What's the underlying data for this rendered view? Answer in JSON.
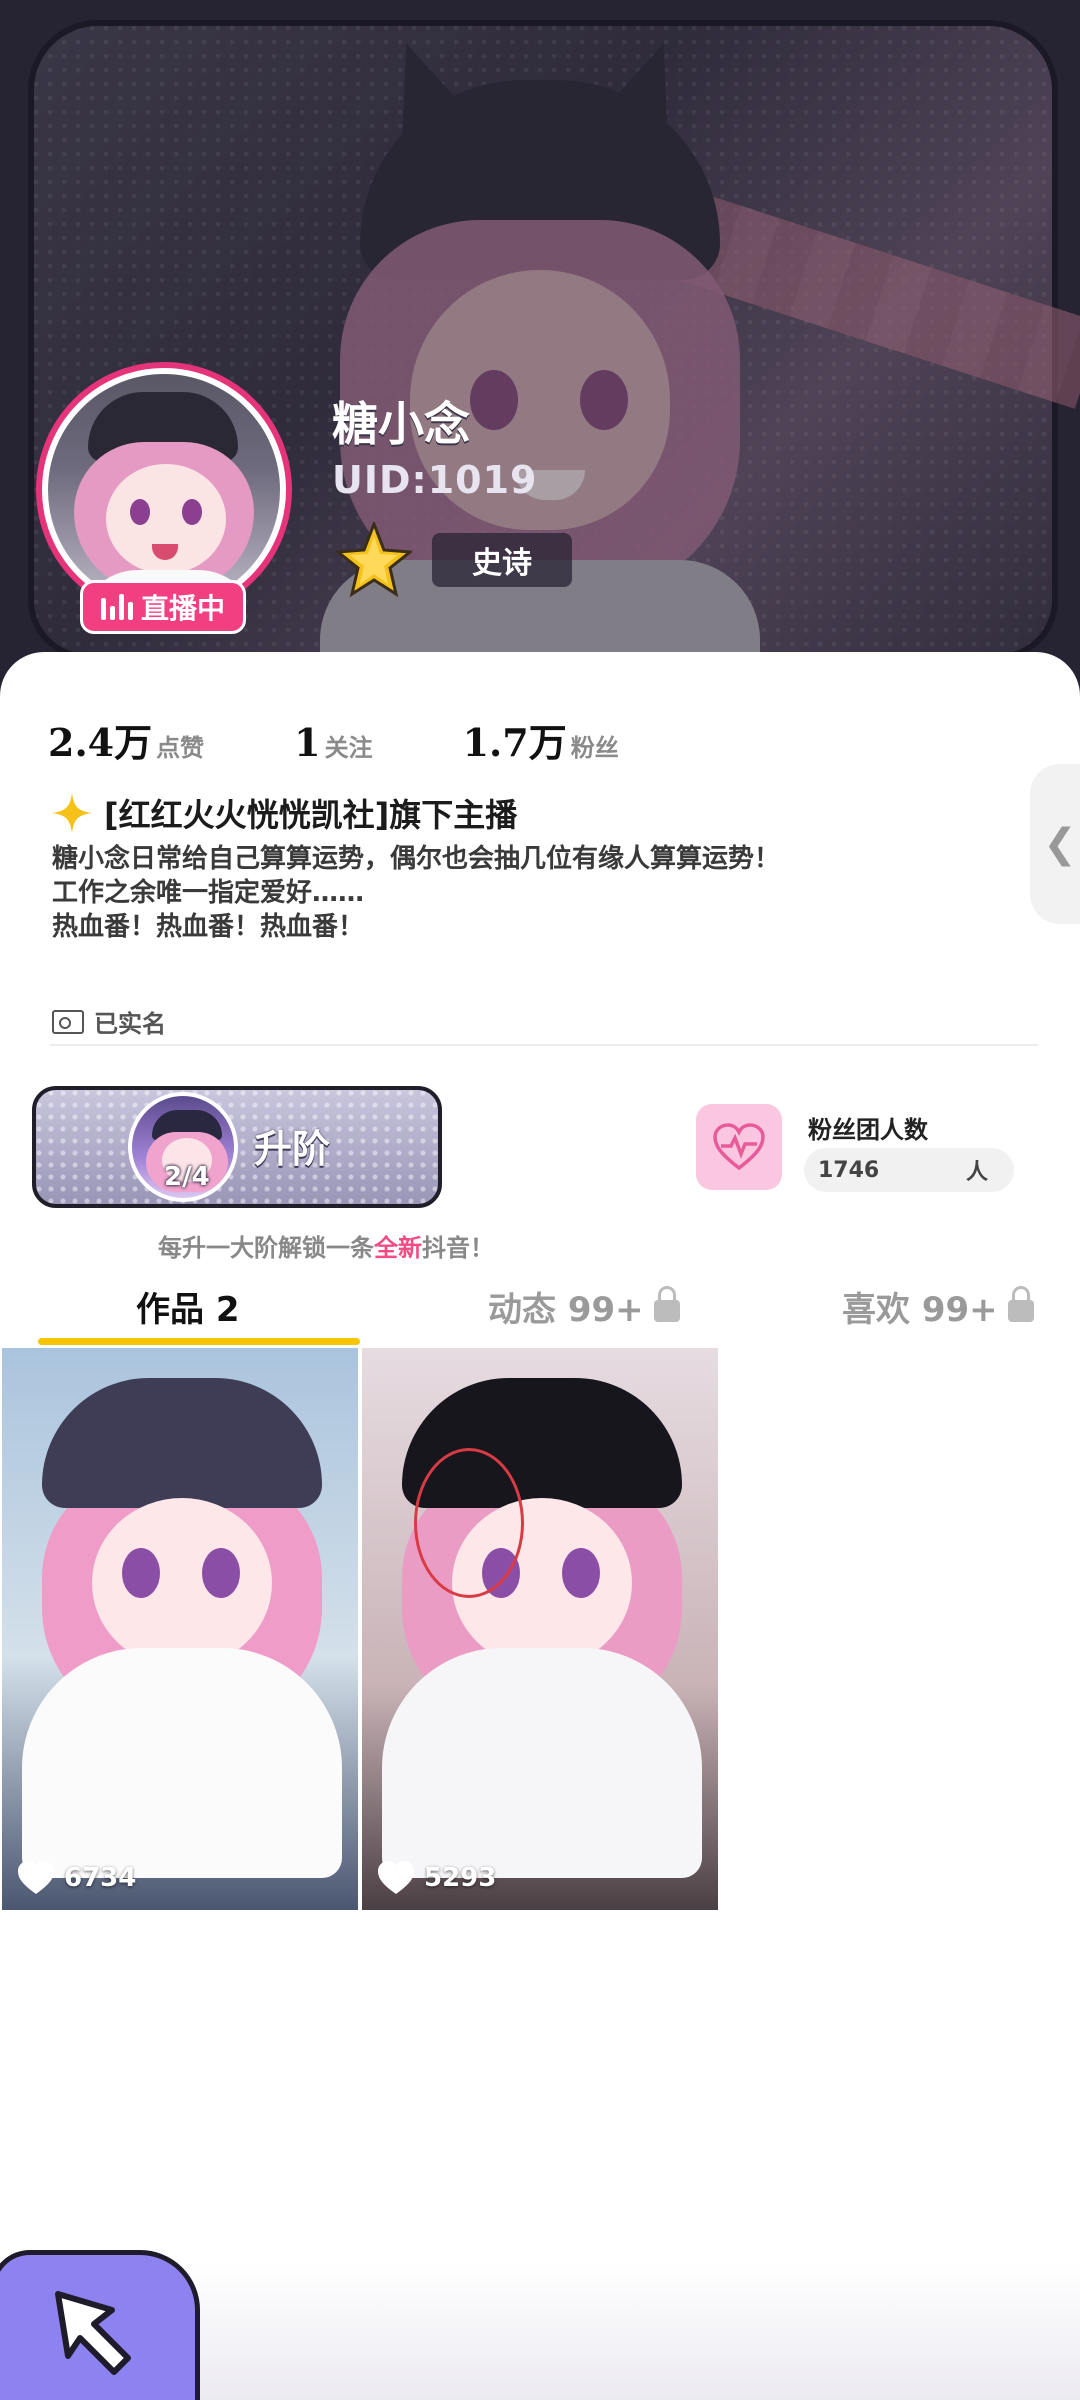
{
  "profile": {
    "name": "糖小念",
    "uid": "UID:1019",
    "live_badge": "直播中",
    "tier_label": "史诗"
  },
  "stats": [
    {
      "value": "2.4万",
      "label": "点赞"
    },
    {
      "value": "1",
      "label": "关注"
    },
    {
      "value": "1.7万",
      "label": "粉丝"
    }
  ],
  "team": {
    "text": "[红红火火恍恍凯社]旗下主播"
  },
  "bio": {
    "line1": "糖小念日常给自己算算运势，偶尔也会抽几位有缘人算算运势！",
    "line2": "工作之余唯一指定爱好……",
    "line3": "热血番！热血番！热血番！"
  },
  "verified": "已实名",
  "upgrade": {
    "label": "升阶",
    "progress": "2/4",
    "tip_prefix": "每升一大阶解锁一条",
    "tip_highlight": "全新",
    "tip_suffix": "抖音！"
  },
  "fan_club": {
    "title": "粉丝团人数",
    "count": "1746",
    "unit": "人"
  },
  "tabs": [
    {
      "label": "作品 2",
      "active": true
    },
    {
      "label": "动态 99+",
      "active": false,
      "locked": true
    },
    {
      "label": "喜欢 99+",
      "active": false,
      "locked": true
    }
  ],
  "works": [
    {
      "likes": "6734"
    },
    {
      "likes": "5293"
    }
  ],
  "side_tab": "❮",
  "colors": {
    "accent_pink": "#f23f82",
    "tab_underline": "#f7c600",
    "float_button": "#8e82f1"
  }
}
